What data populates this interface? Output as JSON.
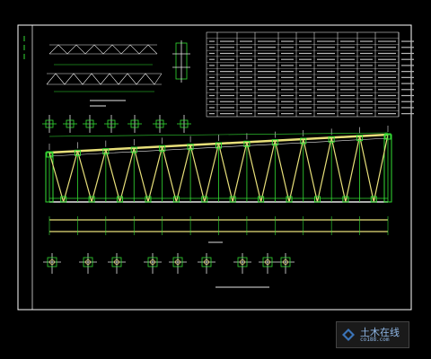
{
  "drawing": {
    "background": "#000000",
    "colors": {
      "frame": "#ffffff",
      "structure": "#e6e6e6",
      "members": "#33dd33",
      "chord": "#e8e07a",
      "dimension": "#33dd33",
      "table_border": "#ffffff",
      "table_text": "#b8b8b8",
      "watermark_text": "#8fb7e6"
    },
    "main_view_label": "",
    "table_rows": 14,
    "table_cols": 11
  },
  "watermark": {
    "title": "土木在线",
    "subtitle": "co188.com",
    "icon": "watermark-logo-icon"
  }
}
